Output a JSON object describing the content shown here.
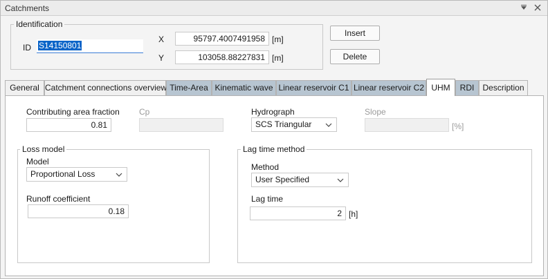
{
  "window": {
    "title": "Catchments"
  },
  "identification": {
    "group_label": "Identification",
    "id_label": "ID",
    "id_value": "S14150801",
    "x_label": "X",
    "x_value": "95797.4007491958",
    "x_unit": "[m]",
    "y_label": "Y",
    "y_value": "103058.88227831",
    "y_unit": "[m]",
    "insert_label": "Insert",
    "delete_label": "Delete"
  },
  "tabs": [
    {
      "label": "General",
      "style": "light"
    },
    {
      "label": "Catchment connections overview",
      "style": "light"
    },
    {
      "label": "Time-Area",
      "style": "dark"
    },
    {
      "label": "Kinematic wave",
      "style": "dark"
    },
    {
      "label": "Linear reservoir C1",
      "style": "dark"
    },
    {
      "label": "Linear reservoir C2",
      "style": "dark"
    },
    {
      "label": "UHM",
      "style": "active"
    },
    {
      "label": "RDI",
      "style": "dark"
    },
    {
      "label": "Description",
      "style": "light"
    }
  ],
  "uhm": {
    "contributing_area_label": "Contributing area fraction",
    "contributing_area_value": "0.81",
    "cp_label": "Cp",
    "cp_value": "",
    "hydrograph_label": "Hydrograph",
    "hydrograph_value": "SCS Triangular",
    "slope_label": "Slope",
    "slope_value": "",
    "slope_unit": "[%]",
    "loss_model": {
      "group_label": "Loss model",
      "model_label": "Model",
      "model_value": "Proportional Loss",
      "runoff_label": "Runoff coefficient",
      "runoff_value": "0.18"
    },
    "lag_time_method": {
      "group_label": "Lag time method",
      "method_label": "Method",
      "method_value": "User Specified",
      "lag_time_label": "Lag time",
      "lag_time_value": "2",
      "lag_time_unit": "[h]"
    }
  }
}
